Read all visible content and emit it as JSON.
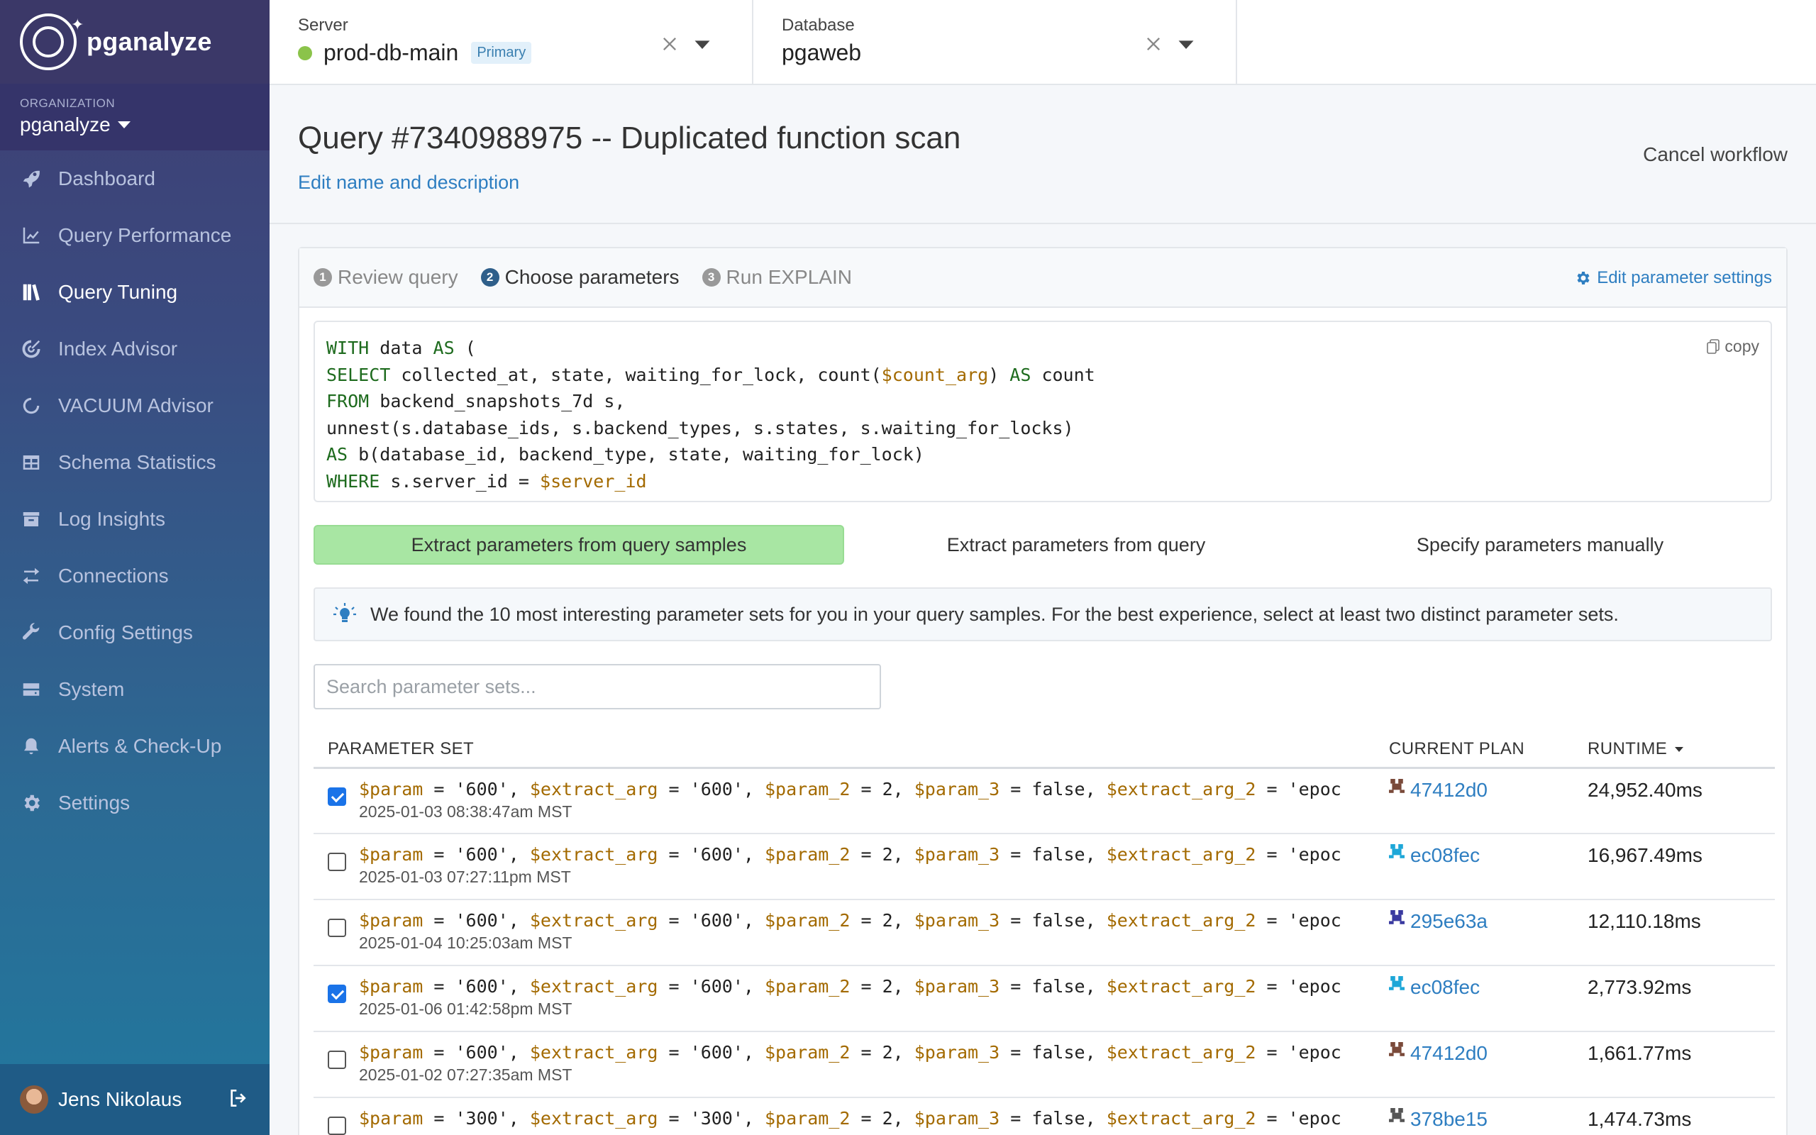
{
  "brand": {
    "name": "pganalyze"
  },
  "org": {
    "label": "ORGANIZATION",
    "name": "pganalyze"
  },
  "nav": [
    {
      "label": "Dashboard",
      "icon": "rocket-icon"
    },
    {
      "label": "Query Performance",
      "icon": "chart-icon"
    },
    {
      "label": "Query Tuning",
      "icon": "books-icon",
      "active": true
    },
    {
      "label": "Index Advisor",
      "icon": "target-icon"
    },
    {
      "label": "VACUUM Advisor",
      "icon": "circle-icon"
    },
    {
      "label": "Schema Statistics",
      "icon": "table-icon"
    },
    {
      "label": "Log Insights",
      "icon": "archive-icon"
    },
    {
      "label": "Connections",
      "icon": "arrows-icon"
    },
    {
      "label": "Config Settings",
      "icon": "wrench-icon"
    },
    {
      "label": "System",
      "icon": "server-icon"
    },
    {
      "label": "Alerts & Check-Up",
      "icon": "bell-icon"
    },
    {
      "label": "Settings",
      "icon": "gear-icon"
    }
  ],
  "user": {
    "name": "Jens Nikolaus"
  },
  "server": {
    "label": "Server",
    "value": "prod-db-main",
    "badge": "Primary",
    "status_color": "#8bc34a"
  },
  "database": {
    "label": "Database",
    "value": "pgaweb"
  },
  "page": {
    "title": "Query #7340988975 -- Duplicated function scan",
    "edit_link": "Edit name and description",
    "cancel": "Cancel workflow"
  },
  "steps": [
    {
      "num": "1",
      "label": "Review query"
    },
    {
      "num": "2",
      "label": "Choose parameters"
    },
    {
      "num": "3",
      "label": "Run EXPLAIN"
    }
  ],
  "param_settings": "Edit parameter settings",
  "copy_label": "copy",
  "query_lines": [
    [
      {
        "t": "WITH",
        "c": "kw"
      },
      {
        "t": " data "
      },
      {
        "t": "AS",
        "c": "kw"
      },
      {
        "t": " ("
      }
    ],
    [
      {
        "t": "SELECT",
        "c": "kw"
      },
      {
        "t": " collected_at, state, waiting_for_lock, count("
      },
      {
        "t": "$count_arg",
        "c": "var"
      },
      {
        "t": ") "
      },
      {
        "t": "AS",
        "c": "kw"
      },
      {
        "t": " count"
      }
    ],
    [
      {
        "t": "FROM",
        "c": "kw"
      },
      {
        "t": " backend_snapshots_7d s,"
      }
    ],
    [
      {
        "t": "unnest(s.database_ids, s.backend_types, s.states, s.waiting_for_locks)"
      }
    ],
    [
      {
        "t": "AS",
        "c": "kw"
      },
      {
        "t": " b(database_id, backend_type, state, waiting_for_lock)"
      }
    ],
    [
      {
        "t": "WHERE",
        "c": "kw"
      },
      {
        "t": " s.server_id = "
      },
      {
        "t": "$server_id",
        "c": "var"
      }
    ]
  ],
  "modes": [
    "Extract parameters from query samples",
    "Extract parameters from query",
    "Specify parameters manually"
  ],
  "hint": "We found the 10 most interesting parameter sets for you in your query samples. For the best experience, select at least two distinct parameter sets.",
  "search": {
    "placeholder": "Search parameter sets..."
  },
  "table": {
    "headers": {
      "param_set": "PARAMETER SET",
      "plan": "CURRENT PLAN",
      "runtime": "RUNTIME"
    },
    "rows": [
      {
        "checked": true,
        "params": [
          "600",
          "600",
          "2",
          "false"
        ],
        "timestamp": "2025-01-03 08:38:47am MST",
        "plan": "47412d0",
        "plan_color": "#7a4a3a",
        "runtime": "24,952.40ms"
      },
      {
        "checked": false,
        "params": [
          "600",
          "600",
          "2",
          "false"
        ],
        "timestamp": "2025-01-03 07:27:11pm MST",
        "plan": "ec08fec",
        "plan_color": "#1ea7d8",
        "runtime": "16,967.49ms"
      },
      {
        "checked": false,
        "params": [
          "600",
          "600",
          "2",
          "false"
        ],
        "timestamp": "2025-01-04 10:25:03am MST",
        "plan": "295e63a",
        "plan_color": "#3a3aa0",
        "runtime": "12,110.18ms"
      },
      {
        "checked": true,
        "params": [
          "600",
          "600",
          "2",
          "false"
        ],
        "timestamp": "2025-01-06 01:42:58pm MST",
        "plan": "ec08fec",
        "plan_color": "#1ea7d8",
        "runtime": "2,773.92ms"
      },
      {
        "checked": false,
        "params": [
          "600",
          "600",
          "2",
          "false"
        ],
        "timestamp": "2025-01-02 07:27:35am MST",
        "plan": "47412d0",
        "plan_color": "#7a4a3a",
        "runtime": "1,661.77ms"
      },
      {
        "checked": false,
        "params": [
          "300",
          "300",
          "2",
          "false"
        ],
        "timestamp": "",
        "plan": "378be15",
        "plan_color": "#555555",
        "runtime": "1,474.73ms"
      }
    ]
  }
}
